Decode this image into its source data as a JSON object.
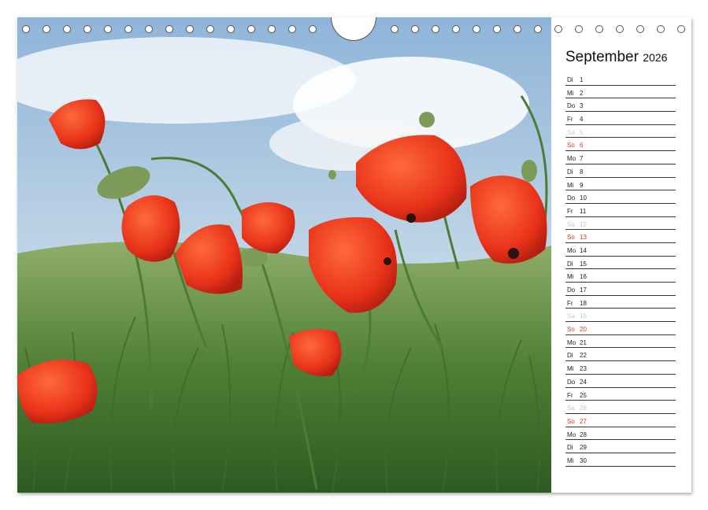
{
  "calendar": {
    "month": "September",
    "year": "2026",
    "photo_subject": "poppy-field",
    "colors": {
      "sunday": "#d23a2a",
      "saturday": "#c8c8c8",
      "text": "#222222"
    },
    "days": [
      {
        "wd": "Di",
        "d": "1"
      },
      {
        "wd": "Mi",
        "d": "2"
      },
      {
        "wd": "Do",
        "d": "3"
      },
      {
        "wd": "Fr",
        "d": "4"
      },
      {
        "wd": "Sa",
        "d": "5",
        "type": "sat"
      },
      {
        "wd": "So",
        "d": "6",
        "type": "sun"
      },
      {
        "wd": "Mo",
        "d": "7"
      },
      {
        "wd": "Di",
        "d": "8"
      },
      {
        "wd": "Mi",
        "d": "9"
      },
      {
        "wd": "Do",
        "d": "10"
      },
      {
        "wd": "Fr",
        "d": "11"
      },
      {
        "wd": "Sa",
        "d": "12",
        "type": "sat"
      },
      {
        "wd": "So",
        "d": "13",
        "type": "sun"
      },
      {
        "wd": "Mo",
        "d": "14"
      },
      {
        "wd": "Di",
        "d": "15"
      },
      {
        "wd": "Mi",
        "d": "16"
      },
      {
        "wd": "Do",
        "d": "17"
      },
      {
        "wd": "Fr",
        "d": "18"
      },
      {
        "wd": "Sa",
        "d": "19",
        "type": "sat"
      },
      {
        "wd": "So",
        "d": "20",
        "type": "sun"
      },
      {
        "wd": "Mo",
        "d": "21"
      },
      {
        "wd": "Di",
        "d": "22"
      },
      {
        "wd": "Mi",
        "d": "23"
      },
      {
        "wd": "Do",
        "d": "24"
      },
      {
        "wd": "Fr",
        "d": "25"
      },
      {
        "wd": "Sa",
        "d": "26",
        "type": "sat"
      },
      {
        "wd": "So",
        "d": "27",
        "type": "sun"
      },
      {
        "wd": "Mo",
        "d": "28"
      },
      {
        "wd": "Di",
        "d": "29"
      },
      {
        "wd": "Mi",
        "d": "30"
      }
    ]
  }
}
